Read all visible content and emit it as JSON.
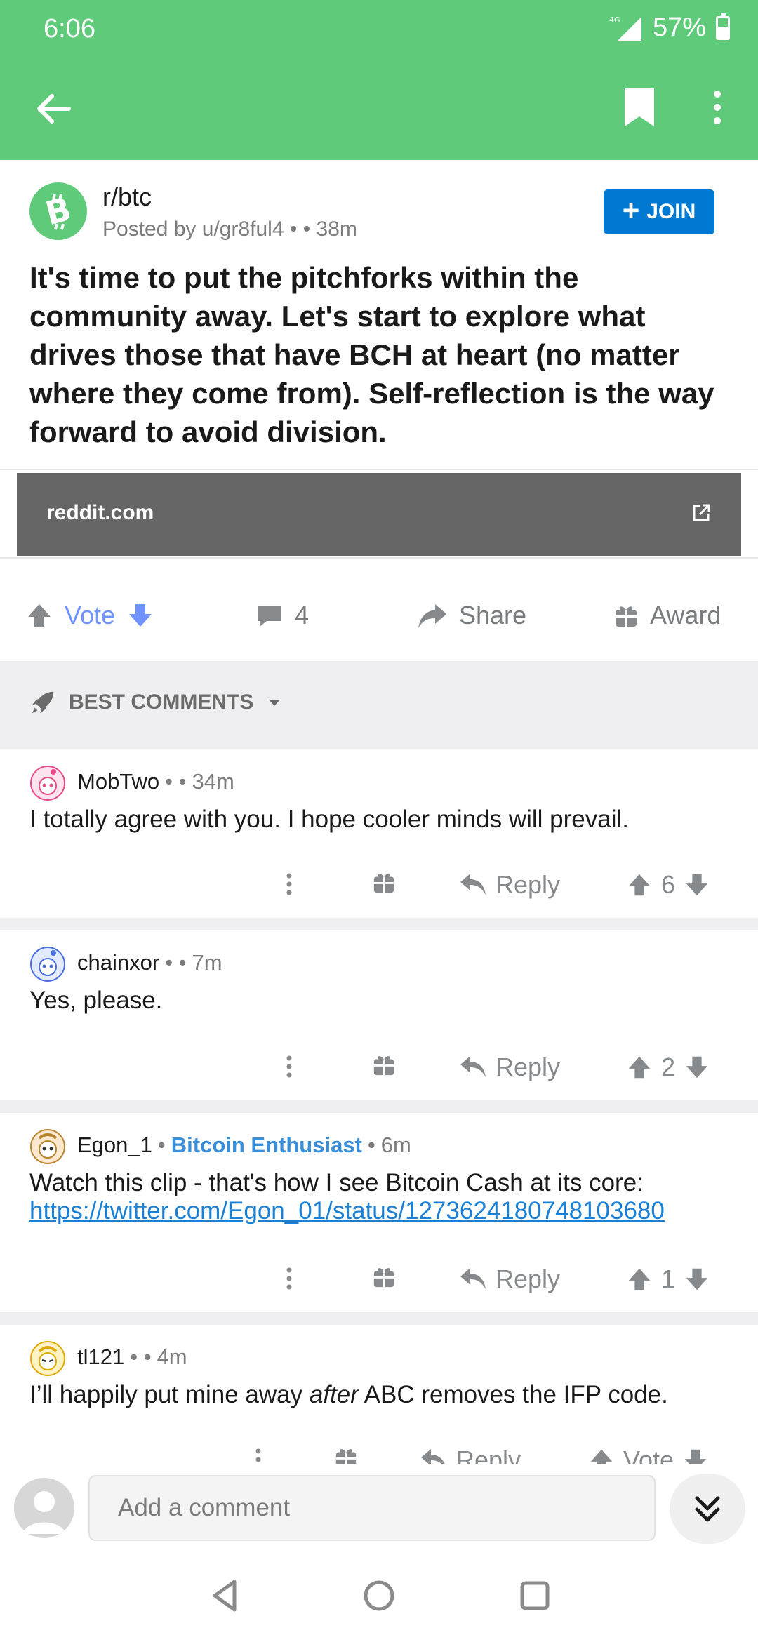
{
  "status": {
    "time": "6:06",
    "network": "4G",
    "battery": "57%"
  },
  "post": {
    "subreddit": "r/btc",
    "posted_by": "Posted by u/gr8ful4",
    "age": "38m",
    "join_label": "JOIN",
    "title": "It's time to put the pitchforks within the community away. Let's start to explore what drives those that have BCH at heart (no matter where they come from). Self-reflection is the way forward to avoid division.",
    "link_domain": "reddit.com",
    "vote_label": "Vote",
    "comment_count": "4",
    "share_label": "Share",
    "award_label": "Award"
  },
  "sort": {
    "label": "BEST COMMENTS"
  },
  "comments": [
    {
      "author": "MobTwo",
      "flair": "",
      "time": "34m",
      "body": "I totally agree with you. I hope cooler minds will prevail.",
      "reply_label": "Reply",
      "score": "6"
    },
    {
      "author": "chainxor",
      "flair": "",
      "time": "7m",
      "body": "Yes, please.",
      "reply_label": "Reply",
      "score": "2"
    },
    {
      "author": "Egon_1",
      "flair": "Bitcoin Enthusiast",
      "time": "6m",
      "body": "Watch this clip - that's how I see Bitcoin Cash at its core:",
      "link": "https://twitter.com/Egon_01/status/1273624180748103680",
      "reply_label": "Reply",
      "score": "1"
    },
    {
      "author": "tl121",
      "flair": "",
      "time": "4m",
      "body_pre": "I’ll happily put mine away ",
      "body_em": "after",
      "body_post": " ABC removes the IFP code.",
      "reply_label": "Reply",
      "score": "Vote"
    }
  ],
  "composer": {
    "placeholder": "Add a comment"
  },
  "colors": {
    "header": "#5fcb7a",
    "join": "#0079d3",
    "vote": "#7193ff",
    "flair": "#3a8fd8"
  }
}
